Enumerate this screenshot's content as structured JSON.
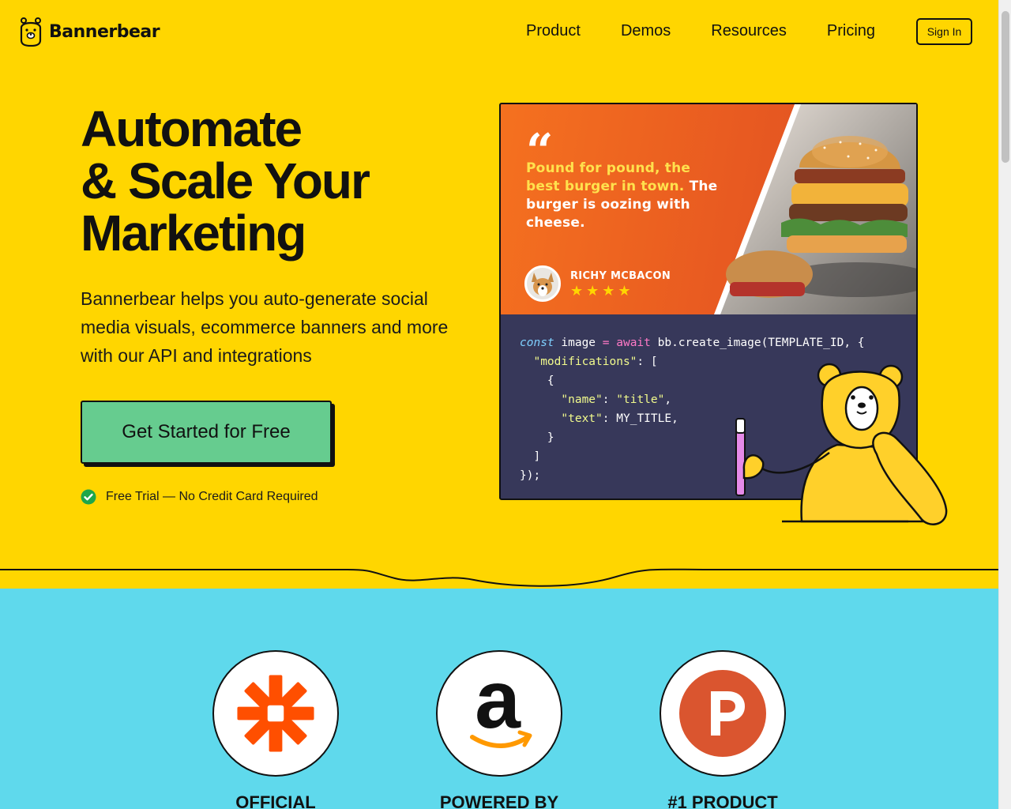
{
  "nav": {
    "brand": "Bannerbear",
    "links": [
      "Product",
      "Demos",
      "Resources",
      "Pricing"
    ],
    "signin": "Sign In"
  },
  "hero": {
    "headline": [
      "Automate",
      "& Scale Your",
      "Marketing"
    ],
    "subcopy": "Bannerbear helps you auto-generate social media visuals, ecommerce banners and more with our API and integrations",
    "cta": "Get Started for Free",
    "trial_note": "Free Trial — No Credit Card Required"
  },
  "demo_card": {
    "quote_mark": "“",
    "quote_highlight": "Pound for pound, the best burger in town.",
    "quote_rest": " The burger is oozing with cheese.",
    "author": "RICHY MCBACON",
    "stars": "★★★★",
    "code": {
      "line1_kw": "const",
      "line1_a": " image ",
      "line1_eq": "=",
      "line1_aw": " await",
      "line1_b": " bb.create_image(TEMPLATE_ID, {",
      "line2_str": "\"modifications\"",
      "line2_b": ": [",
      "line3": "{",
      "line4_k": "\"name\"",
      "line4_v": "\"title\"",
      "line5_k": "\"text\"",
      "line5_v": "MY_TITLE,",
      "line6": "}",
      "line7": "]",
      "line8": "});"
    }
  },
  "badges": [
    {
      "icon": "zapier-logo-icon",
      "label": "OFFICIAL"
    },
    {
      "icon": "amazon-logo-icon",
      "label": "POWERED BY"
    },
    {
      "icon": "product-hunt-logo-icon",
      "label": "#1 PRODUCT"
    }
  ],
  "colors": {
    "hero_bg": "#ffd600",
    "section_bg": "#5fd9ec",
    "cta_bg": "#66cc8f",
    "code_bg": "#37385a"
  }
}
